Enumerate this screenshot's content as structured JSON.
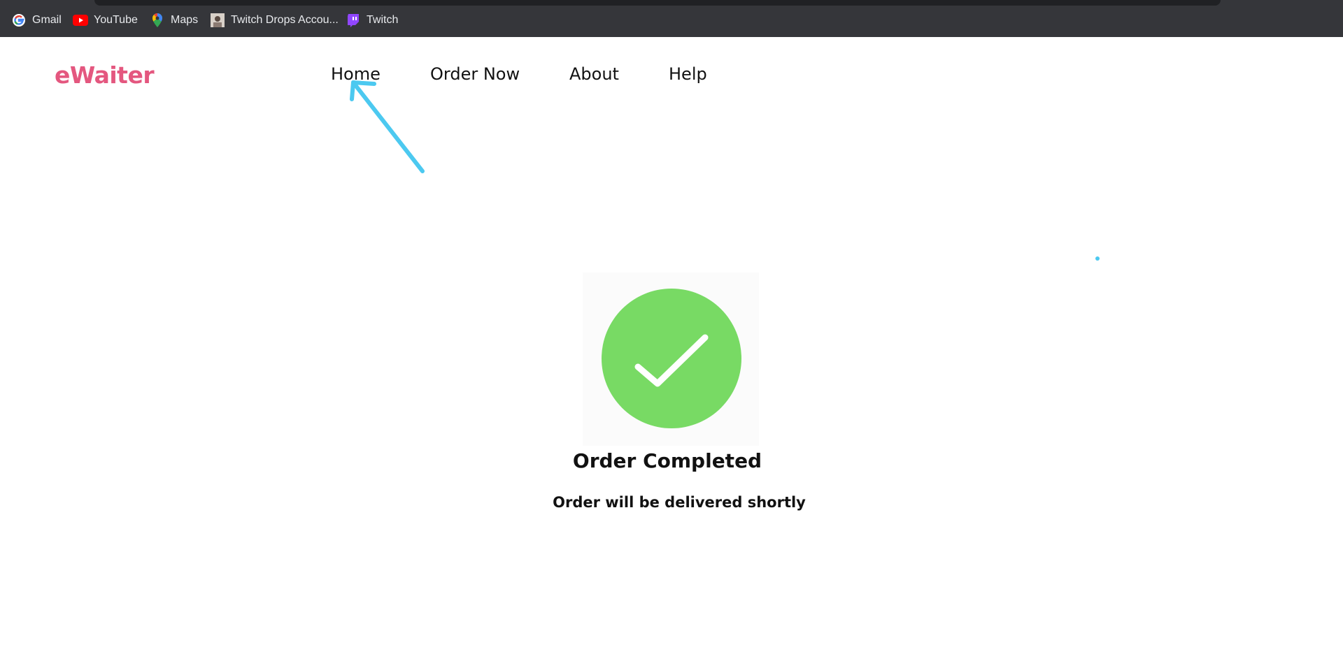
{
  "bookmarks": [
    {
      "label": "Gmail",
      "icon": "google-icon"
    },
    {
      "label": "YouTube",
      "icon": "youtube-icon"
    },
    {
      "label": "Maps",
      "icon": "maps-pin-icon"
    },
    {
      "label": "Twitch Drops Accou...",
      "icon": "profile-thumbnail-icon"
    },
    {
      "label": "Twitch",
      "icon": "twitch-icon"
    }
  ],
  "header": {
    "logo": "eWaiter",
    "nav": [
      "Home",
      "Order Now",
      "About",
      "Help"
    ]
  },
  "main": {
    "title": "Order Completed",
    "subtitle": "Order will be delivered shortly",
    "status_icon": "checkmark-icon"
  },
  "annotation": {
    "arrow_icon": "annotation-arrow-icon",
    "dot_icon": "annotation-dot-icon"
  },
  "colors": {
    "brand": "#e4577f",
    "success": "#78da64",
    "annotation": "#4cc9f0",
    "bookmarks_bar": "#35363a"
  }
}
